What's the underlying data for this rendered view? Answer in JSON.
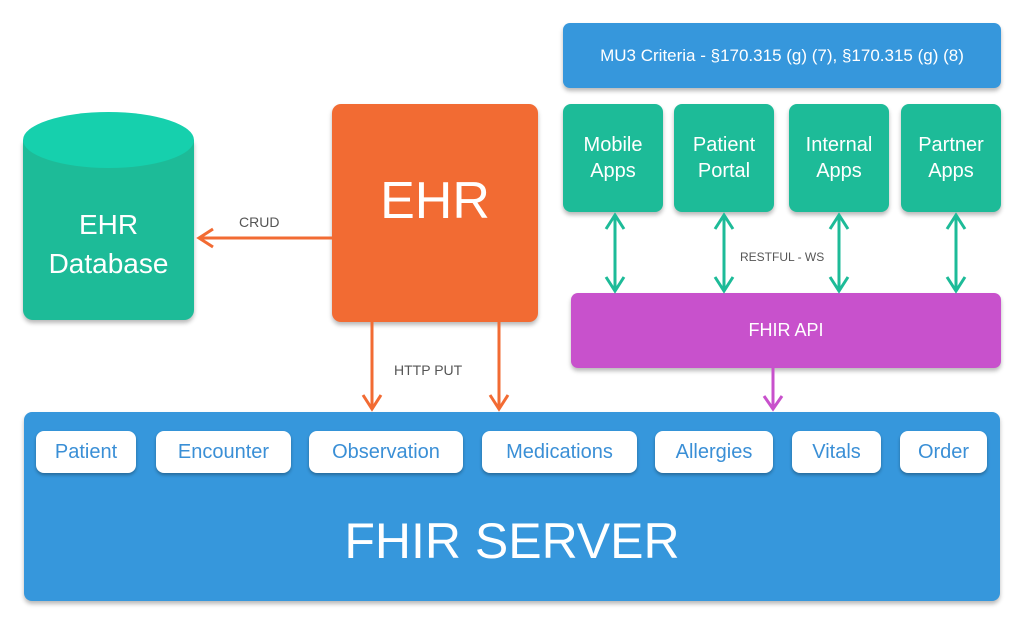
{
  "colors": {
    "teal": "#1dbb98",
    "teal_light": "#16d0ad",
    "orange": "#f26b33",
    "blue": "#3697dc",
    "magenta": "#c851cc",
    "chip_text": "#3a8fd6",
    "label_gray": "#555555"
  },
  "database": {
    "line1": "EHR",
    "line2": "Database"
  },
  "ehr": {
    "label": "EHR"
  },
  "edges": {
    "crud": "CRUD",
    "http_put": "HTTP PUT",
    "restful": "RESTFUL - WS"
  },
  "mu3": {
    "label": "MU3 Criteria - §170.315 (g) (7), §170.315 (g) (8)"
  },
  "apps": [
    {
      "line1": "Mobile",
      "line2": "Apps"
    },
    {
      "line1": "Patient",
      "line2": "Portal"
    },
    {
      "line1": "Internal",
      "line2": "Apps"
    },
    {
      "line1": "Partner",
      "line2": "Apps"
    }
  ],
  "fhir_api": {
    "label": "FHIR API"
  },
  "fhir_server": {
    "label": "FHIR SERVER",
    "resources": [
      "Patient",
      "Encounter",
      "Observation",
      "Medications",
      "Allergies",
      "Vitals",
      "Order"
    ]
  }
}
